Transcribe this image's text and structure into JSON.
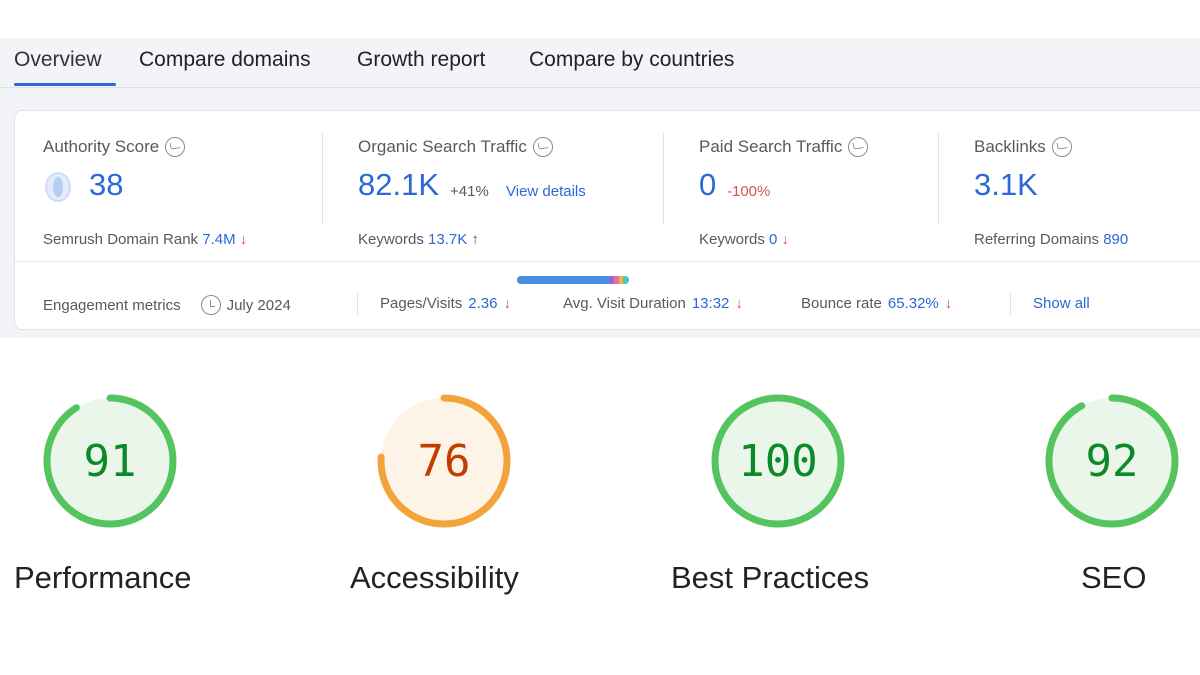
{
  "tabs": [
    {
      "label": "Overview",
      "active": true
    },
    {
      "label": "Compare domains"
    },
    {
      "label": "Growth report"
    },
    {
      "label": "Compare by countries"
    }
  ],
  "metrics": {
    "authority": {
      "title": "Authority Score",
      "value": "38",
      "sub_label": "Semrush Domain Rank",
      "sub_value": "7.4M",
      "sub_arrow": "↓"
    },
    "organic": {
      "title": "Organic Search Traffic",
      "value": "82.1K",
      "delta": "+41%",
      "link": "View details",
      "sub_label": "Keywords",
      "sub_value": "13.7K",
      "sub_arrow": "↑"
    },
    "paid": {
      "title": "Paid Search Traffic",
      "value": "0",
      "delta": "-100%",
      "sub_label": "Keywords",
      "sub_value": "0",
      "sub_arrow": "↓"
    },
    "backlinks": {
      "title": "Backlinks",
      "value": "3.1K",
      "sub_label": "Referring Domains",
      "sub_value": "890"
    }
  },
  "engagement": {
    "label": "Engagement metrics",
    "date": "July 2024",
    "pages_label": "Pages/Visits",
    "pages_value": "2.36",
    "pages_arrow": "↓",
    "duration_label": "Avg. Visit Duration",
    "duration_value": "13:32",
    "duration_arrow": "↓",
    "bounce_label": "Bounce rate",
    "bounce_value": "65.32%",
    "bounce_arrow": "↓",
    "show_all": "Show all"
  },
  "colors": {
    "accent_blue": "#2b69d6",
    "negative_red": "#d9534f",
    "good_green": "#0c8a2a",
    "good_ring": "#53c45e",
    "good_fill": "#eaf6ea",
    "avg_orange": "#c33c00",
    "avg_ring": "#f2a43a",
    "avg_fill": "#fdf3e6"
  },
  "scores": [
    {
      "label": "Performance",
      "value": "91",
      "score": 91,
      "status": "good"
    },
    {
      "label": "Accessibility",
      "value": "76",
      "score": 76,
      "status": "average"
    },
    {
      "label": "Best Practices",
      "value": "100",
      "score": 100,
      "status": "good"
    },
    {
      "label": "SEO",
      "value": "92",
      "score": 92,
      "status": "good"
    }
  ]
}
